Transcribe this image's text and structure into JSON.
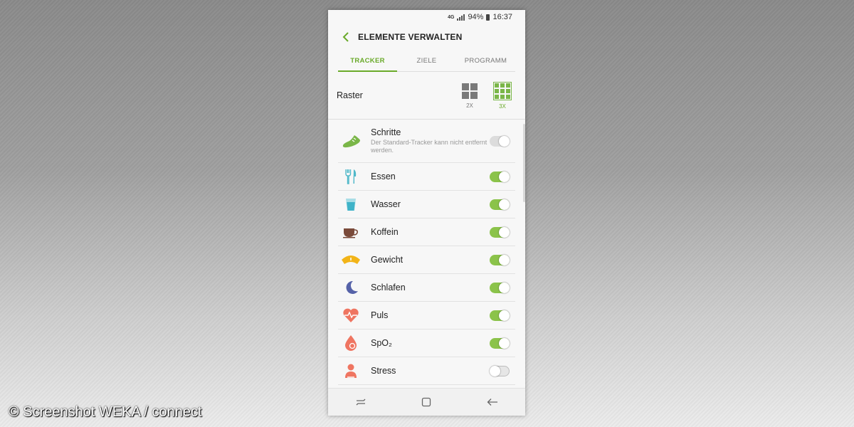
{
  "status_bar": {
    "network": "4G",
    "battery": "94%",
    "time": "16:37"
  },
  "header": {
    "title": "ELEMENTE VERWALTEN",
    "back_icon": "chevron-left-icon"
  },
  "tabs": [
    {
      "label": "TRACKER",
      "active": true
    },
    {
      "label": "ZIELE",
      "active": false
    },
    {
      "label": "PROGRAMM",
      "active": false
    }
  ],
  "raster": {
    "label": "Raster",
    "options": [
      {
        "label": "2X",
        "selected": false
      },
      {
        "label": "3X",
        "selected": true
      }
    ]
  },
  "trackers": [
    {
      "label": "Schritte",
      "sub": "Der Standard-Tracker kann nicht entfernt werden.",
      "icon": "shoe-icon",
      "state": "disabled"
    },
    {
      "label": "Essen",
      "icon": "fork-knife-icon",
      "state": "on"
    },
    {
      "label": "Wasser",
      "icon": "water-glass-icon",
      "state": "on"
    },
    {
      "label": "Koffein",
      "icon": "coffee-cup-icon",
      "state": "on"
    },
    {
      "label": "Gewicht",
      "icon": "scale-icon",
      "state": "on"
    },
    {
      "label": "Schlafen",
      "icon": "moon-icon",
      "state": "on"
    },
    {
      "label": "Puls",
      "icon": "heart-pulse-icon",
      "state": "on"
    },
    {
      "label": "SpO₂",
      "icon": "blood-drop-icon",
      "state": "on"
    },
    {
      "label": "Stress",
      "icon": "stress-person-icon",
      "state": "off"
    }
  ],
  "colors": {
    "accent": "#6aaa2a",
    "toggle_on": "#8bc34a"
  },
  "watermark": "© Screenshot WEKA / connect"
}
